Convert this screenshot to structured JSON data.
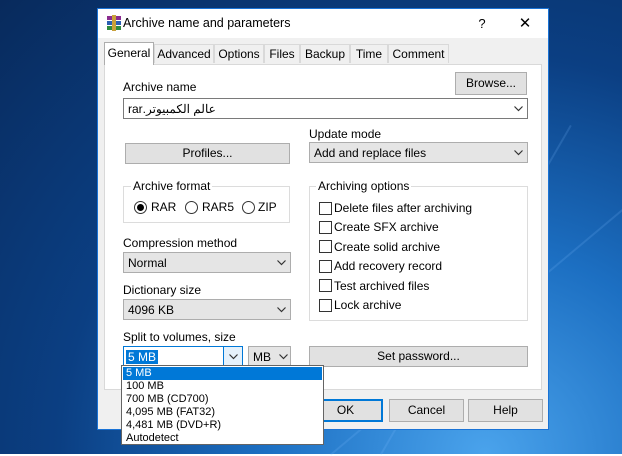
{
  "window": {
    "title": "Archive name and parameters",
    "help_label": "?",
    "close_label": "✕"
  },
  "tabs": [
    "General",
    "Advanced",
    "Options",
    "Files",
    "Backup",
    "Time",
    "Comment"
  ],
  "general": {
    "archive_name_label": "Archive name",
    "archive_name_value": "عالم الكمبيوتر.rar",
    "browse_label": "Browse...",
    "update_mode_label": "Update mode",
    "update_mode_value": "Add and replace files",
    "profiles_label": "Profiles...",
    "archive_format": {
      "label": "Archive format",
      "options": [
        "RAR",
        "RAR5",
        "ZIP"
      ],
      "selected": "RAR"
    },
    "compression_method_label": "Compression method",
    "compression_method_value": "Normal",
    "dictionary_size_label": "Dictionary size",
    "dictionary_size_value": "4096 KB",
    "split_label": "Split to volumes, size",
    "split_value": "5 MB",
    "split_unit": "MB",
    "archiving_options": {
      "label": "Archiving options",
      "items": [
        {
          "label": "Delete files after archiving",
          "checked": false
        },
        {
          "label": "Create SFX archive",
          "checked": false
        },
        {
          "label": "Create solid archive",
          "checked": false
        },
        {
          "label": "Add recovery record",
          "checked": false
        },
        {
          "label": "Test archived files",
          "checked": false
        },
        {
          "label": "Lock archive",
          "checked": false
        }
      ]
    },
    "set_password_label": "Set password..."
  },
  "split_dropdown": {
    "items": [
      "5 MB",
      "100 MB",
      "700 MB  (CD700)",
      "4,095 MB  (FAT32)",
      "4,481 MB  (DVD+R)",
      "Autodetect"
    ],
    "selected_index": 0
  },
  "footer": {
    "ok_label": "OK",
    "cancel_label": "Cancel",
    "help_label": "Help"
  },
  "colors": {
    "accent": "#0078d7",
    "window_border": "#1a73d6"
  }
}
